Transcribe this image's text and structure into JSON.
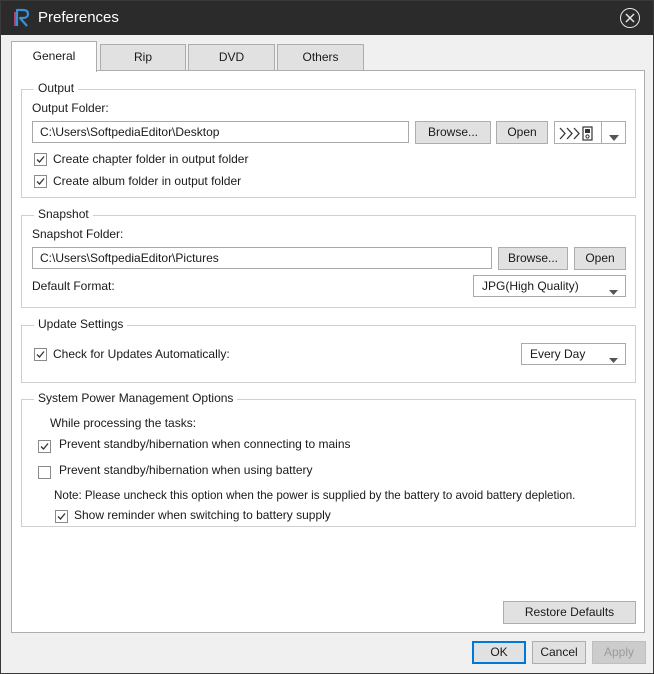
{
  "window": {
    "title": "Preferences"
  },
  "tabs": [
    {
      "label": "General",
      "active": true
    },
    {
      "label": "Rip",
      "active": false
    },
    {
      "label": "DVD",
      "active": false
    },
    {
      "label": "Others",
      "active": false
    }
  ],
  "output": {
    "legend": "Output",
    "folder_label": "Output Folder:",
    "folder_value": "C:\\Users\\SoftpediaEditor\\Desktop",
    "browse_label": "Browse...",
    "open_label": "Open",
    "device_icon": "device-transfer-icon",
    "chapter_folder_label": "Create chapter folder in output folder",
    "chapter_folder_checked": true,
    "album_folder_label": "Create album folder in output folder",
    "album_folder_checked": true
  },
  "snapshot": {
    "legend": "Snapshot",
    "folder_label": "Snapshot Folder:",
    "folder_value": "C:\\Users\\SoftpediaEditor\\Pictures",
    "browse_label": "Browse...",
    "open_label": "Open",
    "format_label": "Default Format:",
    "format_value": "JPG(High Quality)"
  },
  "update": {
    "legend": "Update Settings",
    "check_label": "Check for Updates Automatically:",
    "check_checked": true,
    "frequency_value": "Every Day"
  },
  "power": {
    "legend": "System Power Management Options",
    "intro": "While processing the tasks:",
    "mains_label": "Prevent standby/hibernation when connecting to mains",
    "mains_checked": true,
    "battery_label": "Prevent standby/hibernation when using battery",
    "battery_checked": false,
    "note": "Note: Please uncheck this option when the power is supplied by the battery to avoid battery depletion.",
    "reminder_label": "Show reminder when switching to battery supply",
    "reminder_checked": true
  },
  "actions": {
    "restore_label": "Restore Defaults",
    "ok_label": "OK",
    "cancel_label": "Cancel",
    "apply_label": "Apply"
  },
  "colors": {
    "titlebar": "#2b2b2b",
    "logo_accent": "#3a8fd6",
    "focus_border": "#0078d7"
  }
}
